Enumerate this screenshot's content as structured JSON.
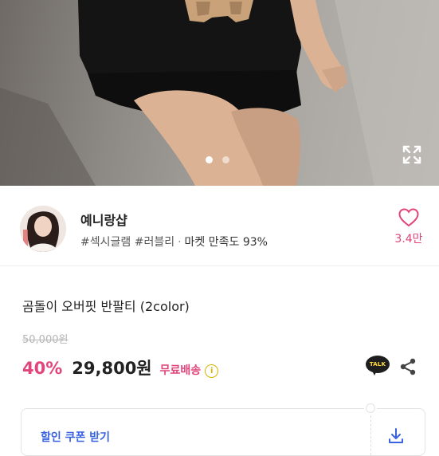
{
  "gallery": {
    "current_index": 1,
    "total": 2,
    "expand_icon": "expand-icon"
  },
  "shop": {
    "name": "예니랑샵",
    "tags": [
      "#섹시글램",
      "#러블리"
    ],
    "separator": "·",
    "satisfaction": "마켓 만족도 93%",
    "like_icon": "heart-outline-icon",
    "like_count": "3.4만"
  },
  "product": {
    "title": "곰돌이 오버핏 반팔티 (2color)",
    "original_price": "50,000원",
    "discount": "40%",
    "price": "29,800원",
    "shipping": "무료배송",
    "info_icon": "info-icon",
    "talk_icon_text": "TALK",
    "share_icon": "share-icon"
  },
  "coupon": {
    "label": "할인 쿠폰 받기",
    "download_icon": "download-icon"
  },
  "colors": {
    "accent_pink": "#e0457b",
    "coupon_blue": "#3a63e0",
    "talk_yellow": "#ffdd3a"
  }
}
